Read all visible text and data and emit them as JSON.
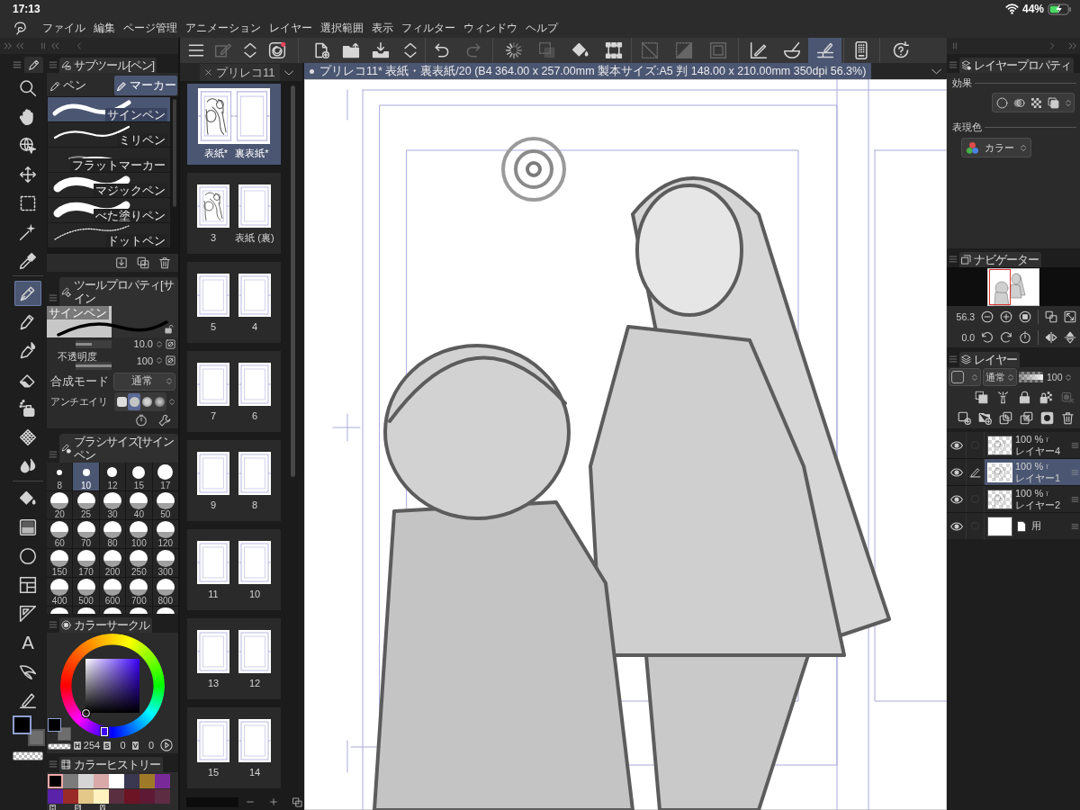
{
  "status_bar": {
    "time": "17:13",
    "battery": "44%"
  },
  "menu_bar": {
    "items": [
      "ファイル",
      "編集",
      "ページ管理",
      "アニメーション",
      "レイヤー",
      "選択範囲",
      "表示",
      "フィルター",
      "ウィンドウ",
      "ヘルプ"
    ]
  },
  "toolbar": {
    "groups": [
      [
        {
          "kind": "menu",
          "selected": false,
          "disabled": false
        },
        {
          "kind": "edit",
          "selected": false,
          "disabled": true
        },
        {
          "kind": "updown",
          "selected": false,
          "disabled": false
        },
        {
          "kind": "logo",
          "selected": false,
          "disabled": false
        }
      ],
      [
        {
          "kind": "new",
          "selected": false,
          "disabled": false
        },
        {
          "kind": "open",
          "selected": false,
          "disabled": false
        },
        {
          "kind": "save",
          "selected": false,
          "disabled": false
        },
        {
          "kind": "updown",
          "selected": false,
          "disabled": false
        }
      ],
      [
        {
          "kind": "undo",
          "selected": false,
          "disabled": false
        },
        {
          "kind": "redo",
          "selected": false,
          "disabled": true
        }
      ],
      [
        {
          "kind": "spinner",
          "selected": false,
          "disabled": false
        },
        {
          "kind": "transform",
          "selected": false,
          "disabled": true
        },
        {
          "kind": "fill",
          "selected": false,
          "disabled": false
        },
        {
          "kind": "crop",
          "selected": false,
          "disabled": false
        }
      ],
      [
        {
          "kind": "clear",
          "selected": false,
          "disabled": true
        },
        {
          "kind": "fillsel",
          "selected": false,
          "disabled": true
        },
        {
          "kind": "border",
          "selected": false,
          "disabled": true
        }
      ],
      [
        {
          "kind": "rulerpen",
          "selected": false,
          "disabled": false
        },
        {
          "kind": "bowl",
          "selected": false,
          "disabled": false
        },
        {
          "kind": "snap",
          "selected": true,
          "disabled": false
        }
      ],
      [
        {
          "kind": "device",
          "selected": false,
          "disabled": false
        }
      ],
      [
        {
          "kind": "help",
          "selected": false,
          "disabled": false
        }
      ]
    ]
  },
  "tool_palette": {
    "groups": [
      [
        {
          "kind": "zoom",
          "selected": false
        },
        {
          "kind": "hand",
          "selected": false
        },
        {
          "kind": "object",
          "selected": false
        },
        {
          "kind": "move",
          "selected": false
        },
        {
          "kind": "selection",
          "selected": false
        },
        {
          "kind": "wand",
          "selected": false
        },
        {
          "kind": "eyedropper",
          "selected": false
        }
      ],
      [
        {
          "kind": "pen",
          "selected": true
        },
        {
          "kind": "pencil",
          "selected": false
        },
        {
          "kind": "brush",
          "selected": false
        },
        {
          "kind": "eraser",
          "selected": false
        },
        {
          "kind": "airbrush",
          "selected": false
        },
        {
          "kind": "decoration",
          "selected": false
        },
        {
          "kind": "blend",
          "selected": false
        }
      ],
      [
        {
          "kind": "fill",
          "selected": false
        },
        {
          "kind": "gradient",
          "selected": false
        },
        {
          "kind": "figure",
          "selected": false
        },
        {
          "kind": "frame",
          "selected": false
        },
        {
          "kind": "ruler",
          "selected": false
        },
        {
          "kind": "text",
          "glyph": "A",
          "selected": false
        },
        {
          "kind": "balloon",
          "selected": false
        },
        {
          "kind": "correction",
          "selected": false
        }
      ]
    ],
    "colors": [
      {
        "kind": "main",
        "color": "#000000",
        "selected": true
      },
      {
        "kind": "sub",
        "color": "#6e6e6e",
        "selected": false
      }
    ]
  },
  "sub_tool": {
    "title": "サブツール[ペン]",
    "groups": [
      {
        "kind": "pen",
        "label": "ペン",
        "selected": false
      },
      {
        "kind": "marker",
        "label": "マーカー",
        "selected": true
      }
    ],
    "brushes": [
      {
        "label": "サインペン",
        "kind": "round",
        "selected": true
      },
      {
        "label": "ミリペン",
        "kind": "thin",
        "selected": false
      },
      {
        "label": "フラットマーカー",
        "kind": "flat",
        "selected": false
      },
      {
        "label": "マジックペン",
        "kind": "bold",
        "selected": false
      },
      {
        "label": "べた塗りペン",
        "kind": "bold",
        "selected": false
      },
      {
        "label": "ドットペン",
        "kind": "dotted",
        "selected": false
      }
    ]
  },
  "tool_property": {
    "title": "ツールプロパティ[サイン",
    "preview_label": "サインペン",
    "rows": [
      {
        "kind": "slider",
        "value": "10.0",
        "level": 0.45
      },
      {
        "kind": "slider",
        "label": "不透明度",
        "value": "100",
        "level": 1
      },
      {
        "kind": "dropdown",
        "label": "合成モード",
        "value": "通常"
      },
      {
        "kind": "options",
        "label": "アンチエイリ",
        "options": [
          {
            "selected": false
          },
          {
            "selected": true
          },
          {
            "selected": false
          },
          {
            "selected": false
          }
        ]
      }
    ]
  },
  "brush_size": {
    "title": "ブラシサイズ[サインペン",
    "sizes": [
      {
        "label": "8",
        "selected": false
      },
      {
        "label": "10",
        "selected": true
      },
      {
        "label": "12",
        "selected": false
      },
      {
        "label": "15",
        "selected": false
      },
      {
        "label": "17",
        "selected": false
      },
      {
        "label": "20",
        "selected": false
      },
      {
        "label": "25",
        "selected": false
      },
      {
        "label": "30",
        "selected": false
      },
      {
        "label": "40",
        "selected": false
      },
      {
        "label": "50",
        "selected": false
      },
      {
        "label": "60",
        "selected": false
      },
      {
        "label": "70",
        "selected": false
      },
      {
        "label": "80",
        "selected": false
      },
      {
        "label": "100",
        "selected": false
      },
      {
        "label": "120",
        "selected": false
      },
      {
        "label": "150",
        "selected": false
      },
      {
        "label": "170",
        "selected": false
      },
      {
        "label": "200",
        "selected": false
      },
      {
        "label": "250",
        "selected": false
      },
      {
        "label": "300",
        "selected": false
      },
      {
        "label": "400",
        "selected": false
      },
      {
        "label": "500",
        "selected": false
      },
      {
        "label": "600",
        "selected": false
      },
      {
        "label": "700",
        "selected": false
      },
      {
        "label": "800",
        "selected": false
      },
      {
        "selected": false
      },
      {
        "selected": false
      },
      {
        "selected": false
      },
      {
        "selected": false
      },
      {
        "selected": false
      }
    ]
  },
  "color_circle": {
    "title": "カラーサークル",
    "saturation": {
      "level": 0
    },
    "brightness": {
      "level": 0
    },
    "swatches": [
      {
        "color": "#000000",
        "selected": true
      },
      {
        "color": "#6e6e6e",
        "selected": false
      }
    ],
    "readings": [
      {
        "label": "H",
        "value": "254"
      },
      {
        "label": "S",
        "value": "0"
      },
      {
        "label": "V",
        "value": "0"
      }
    ]
  },
  "color_history": {
    "title": "カラーヒストリー",
    "swatches": [
      {
        "color": "#000000",
        "selected": true
      },
      {
        "color": "#7b7b7b",
        "selected": false
      },
      {
        "color": "#d5d5d5",
        "selected": false
      },
      {
        "color": "#d9a9a9",
        "selected": false
      },
      {
        "color": "#ffffff",
        "selected": false
      },
      {
        "color": "#3a3850",
        "selected": false
      },
      {
        "color": "#9e7a28",
        "selected": false
      },
      {
        "color": "#7a2a98",
        "selected": false
      },
      {
        "color": "#5a22a8",
        "selected": false
      },
      {
        "color": "#9a2a28",
        "selected": false
      },
      {
        "color": "#e3c88a",
        "selected": false
      },
      {
        "color": "#fff2c0",
        "selected": false
      },
      {
        "color": "#5a3040",
        "selected": false
      },
      {
        "color": "#6c1424",
        "selected": false
      },
      {
        "color": "#5e1a34",
        "selected": false
      },
      {
        "color": "#5e2c42",
        "selected": false
      }
    ],
    "labels": [
      "H",
      "S",
      "V"
    ]
  },
  "page_manager": {
    "tab": "プリレコ11",
    "spreads": [
      {
        "selected": true,
        "pages": [
          {
            "label": "表紙*",
            "kind": "sketch"
          },
          {
            "label": "裏表紙*",
            "kind": "blank"
          }
        ]
      },
      {
        "selected": false,
        "pages": [
          {
            "label": "3",
            "kind": "sketch"
          },
          {
            "label": "表紙 (裏)",
            "kind": "blank"
          }
        ]
      },
      {
        "selected": false,
        "pages": [
          {
            "label": "5",
            "kind": "blank"
          },
          {
            "label": "4",
            "kind": "blank"
          }
        ]
      },
      {
        "selected": false,
        "pages": [
          {
            "label": "7",
            "kind": "blank"
          },
          {
            "label": "6",
            "kind": "blank"
          }
        ]
      },
      {
        "selected": false,
        "pages": [
          {
            "label": "9",
            "kind": "blank"
          },
          {
            "label": "8",
            "kind": "blank"
          }
        ]
      },
      {
        "selected": false,
        "pages": [
          {
            "label": "11",
            "kind": "blank"
          },
          {
            "label": "10",
            "kind": "blank"
          }
        ]
      },
      {
        "selected": false,
        "pages": [
          {
            "label": "13",
            "kind": "blank"
          },
          {
            "label": "12",
            "kind": "blank"
          }
        ]
      },
      {
        "selected": false,
        "pages": [
          {
            "label": "15",
            "kind": "blank"
          },
          {
            "label": "14",
            "kind": "blank"
          }
        ]
      }
    ]
  },
  "canvas": {
    "tab": "プリレコ11* 表紙・裏表紙/20 (B4 364.00 x 257.00mm 製本サイズ:A5 判 148.00 x 210.00mm 350dpi 56.3%)"
  },
  "layer_property": {
    "title": "レイヤープロパティ",
    "effect_label": "効果",
    "color_label": "表現色",
    "color_mode": "カラー"
  },
  "navigator": {
    "title": "ナビゲーター",
    "zoom": "56.3",
    "angle": "0.0"
  },
  "layers": {
    "title": "レイヤー",
    "blend_mode": "通常",
    "opacity": "100",
    "opacity_slider": {
      "level": 1
    },
    "tools": [
      [
        {
          "kind": "clip",
          "disabled": false
        },
        {
          "kind": "reference",
          "disabled": false
        },
        {
          "kind": "lock",
          "disabled": false
        },
        {
          "kind": "locktrans",
          "disabled": false
        },
        {
          "kind": "mask",
          "disabled": true
        }
      ],
      [
        {
          "kind": "newlayer",
          "disabled": false
        },
        {
          "kind": "newfolder",
          "disabled": false
        },
        {
          "kind": "copydown",
          "disabled": false
        },
        {
          "kind": "merge",
          "disabled": false
        },
        {
          "kind": "addmask",
          "disabled": false
        },
        {
          "kind": "trash",
          "disabled": false
        }
      ]
    ],
    "items": [
      {
        "kind": "raster",
        "opacity": "100 %",
        "name": "レイヤー4",
        "visible": true,
        "selected": false
      },
      {
        "kind": "raster",
        "opacity": "100 %",
        "name": "レイヤー1",
        "visible": true,
        "selected": true
      },
      {
        "kind": "raster",
        "opacity": "100 %",
        "name": "レイヤー2",
        "visible": true,
        "selected": false
      },
      {
        "kind": "paper",
        "name": "用",
        "visible": true,
        "selected": false
      }
    ]
  }
}
